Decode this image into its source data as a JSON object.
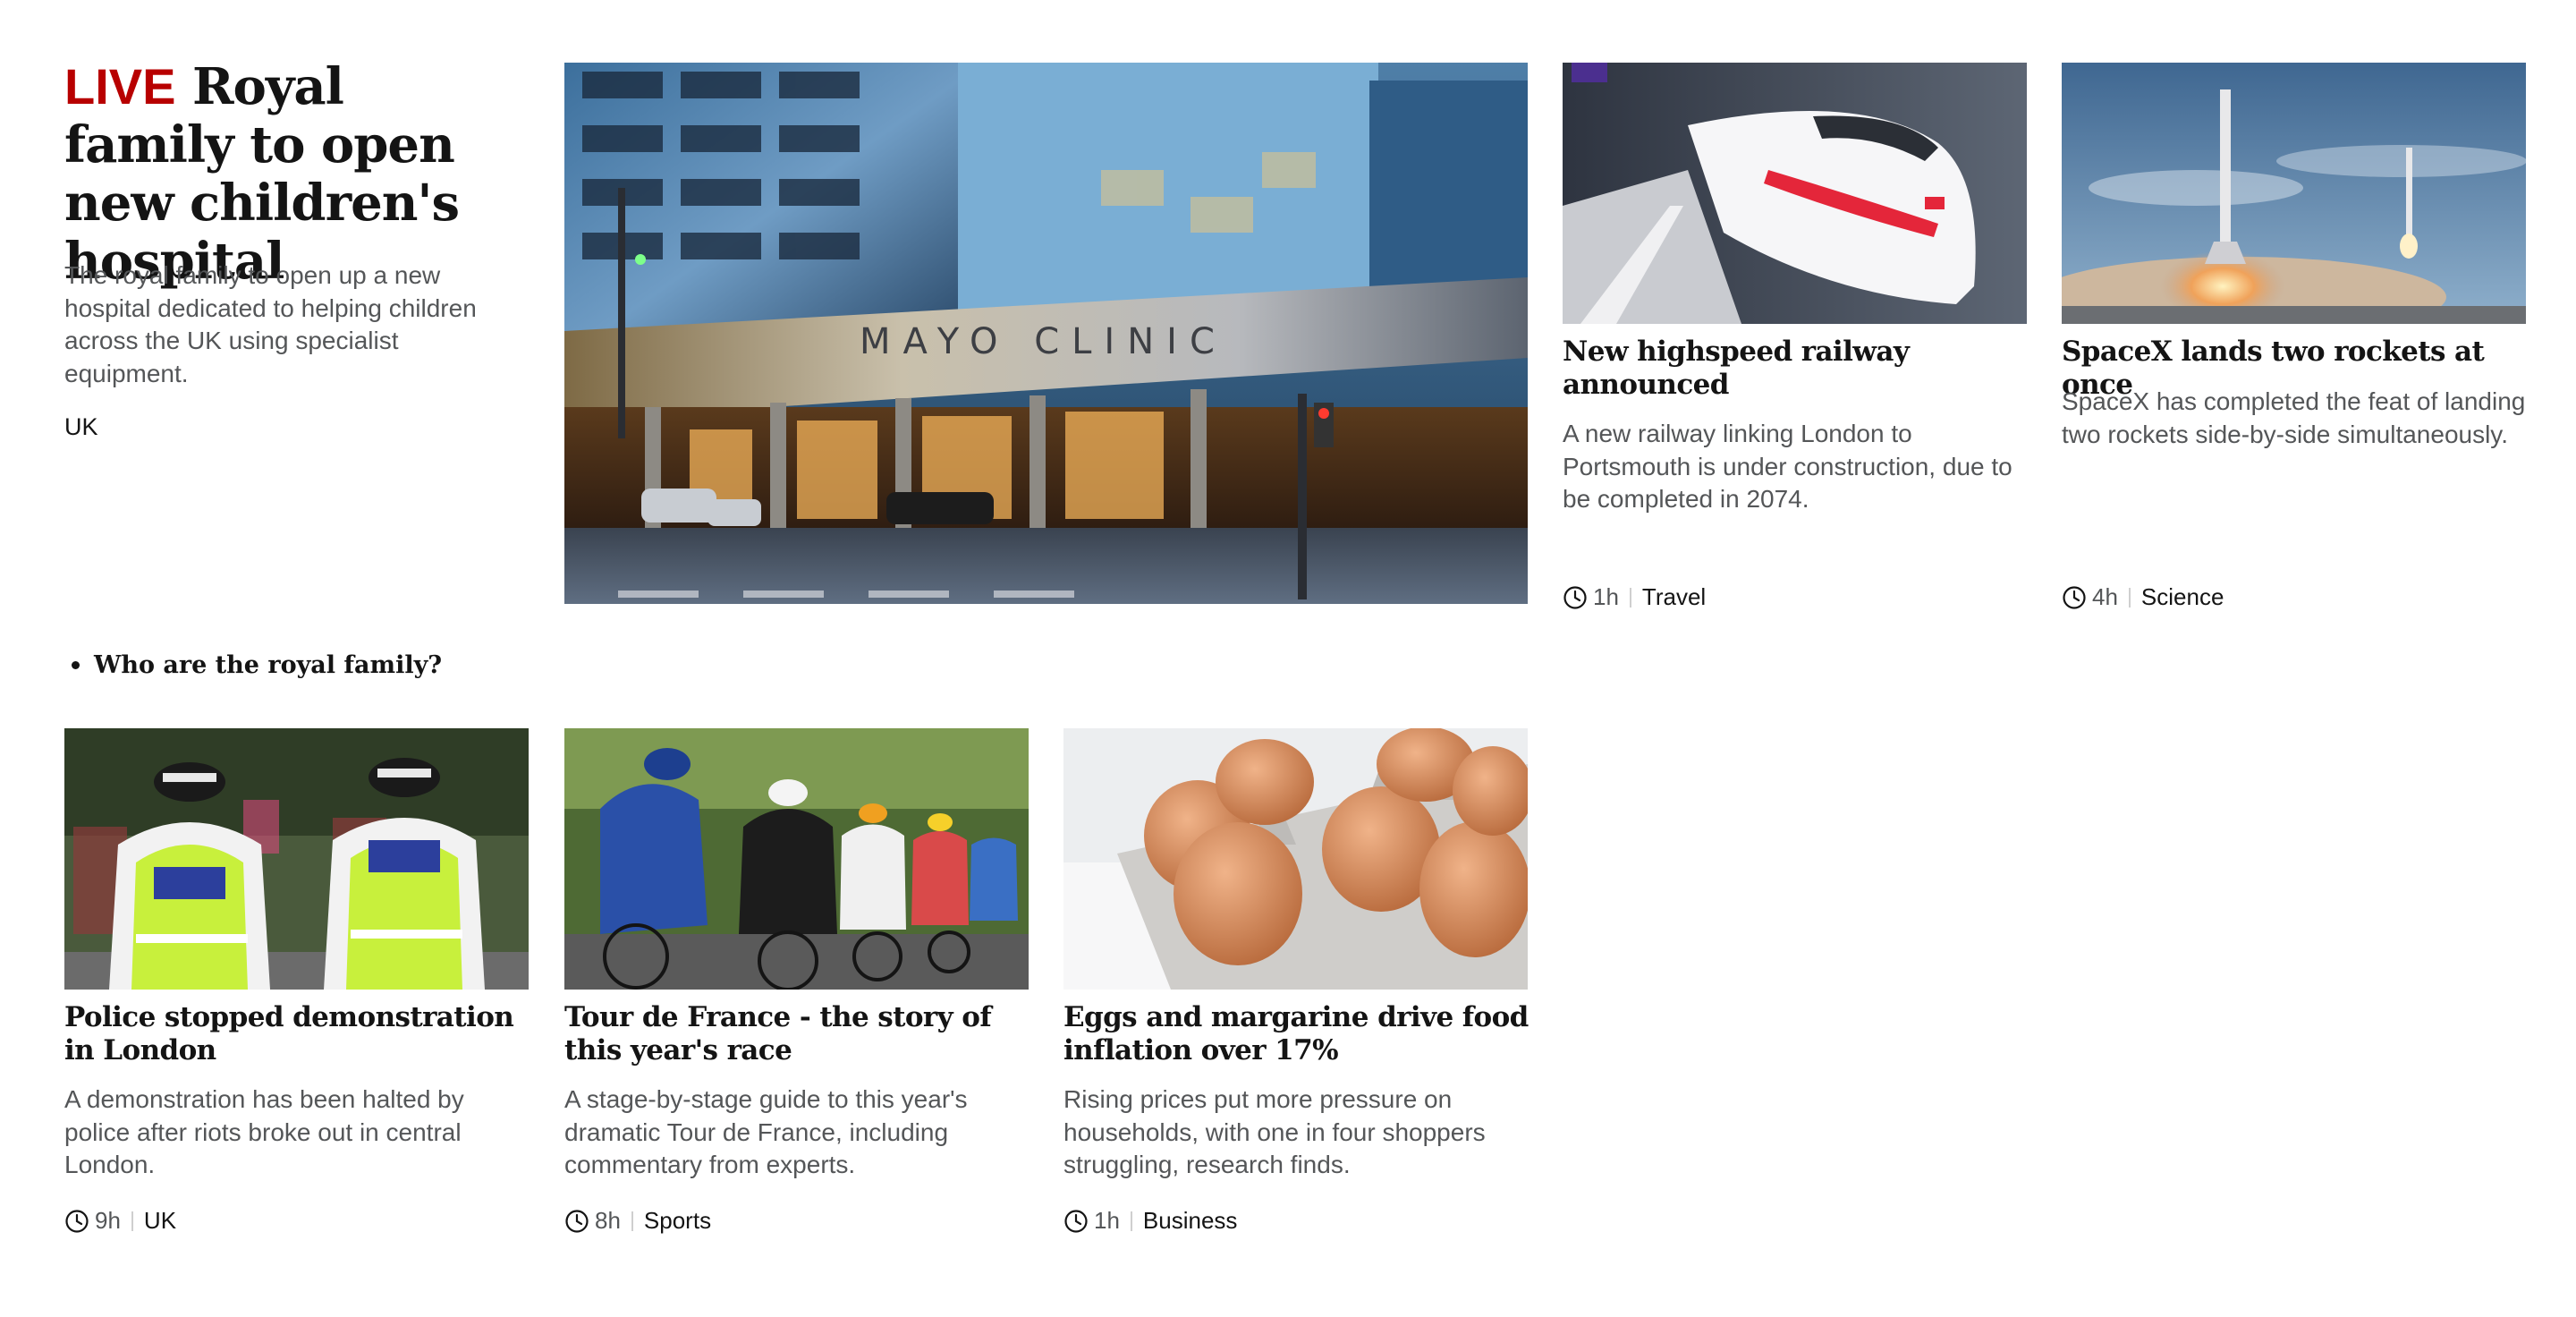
{
  "lead": {
    "live_label": "LIVE",
    "headline": "Royal family to open new children's hospital",
    "summary": "The royal family to open up a new hospital dedicated to helping children across the UK using specialist equipment.",
    "tag": "UK",
    "image": "mayo-clinic-building-photo",
    "image_signage": "MAYO CLINIC"
  },
  "related": {
    "items": [
      {
        "label": "Who are the royal family?"
      }
    ]
  },
  "cards": [
    {
      "headline": "New highspeed railway announced",
      "summary": "A new railway linking London to Portsmouth is under construction, due to be completed in 2074.",
      "time": "1h",
      "category": "Travel",
      "image": "highspeed-train-photo"
    },
    {
      "headline": "SpaceX lands two rockets at once",
      "summary": "SpaceX has completed the feat of landing two rockets side-by-side simultaneously.",
      "time": "4h",
      "category": "Science",
      "image": "rocket-landing-photo"
    },
    {
      "headline": "Police stopped demonstration in London",
      "summary": "A demonstration has been halted by police after riots broke out in central London.",
      "time": "9h",
      "category": "UK",
      "image": "police-officers-photo"
    },
    {
      "headline": "Tour de France - the story of this year's race",
      "summary": "A stage-by-stage guide to this year's dramatic Tour de France, including commentary from experts.",
      "time": "8h",
      "category": "Sports",
      "image": "cyclists-peloton-photo"
    },
    {
      "headline": "Eggs and margarine drive food inflation over 17%",
      "summary": "Rising prices put more pressure on households, with one in four shoppers struggling, research finds.",
      "time": "1h",
      "category": "Business",
      "image": "eggs-carton-photo"
    }
  ],
  "colors": {
    "live": "#b80000",
    "headline": "#141414",
    "summary": "#545658"
  },
  "icons": {
    "time": "clock-icon"
  }
}
